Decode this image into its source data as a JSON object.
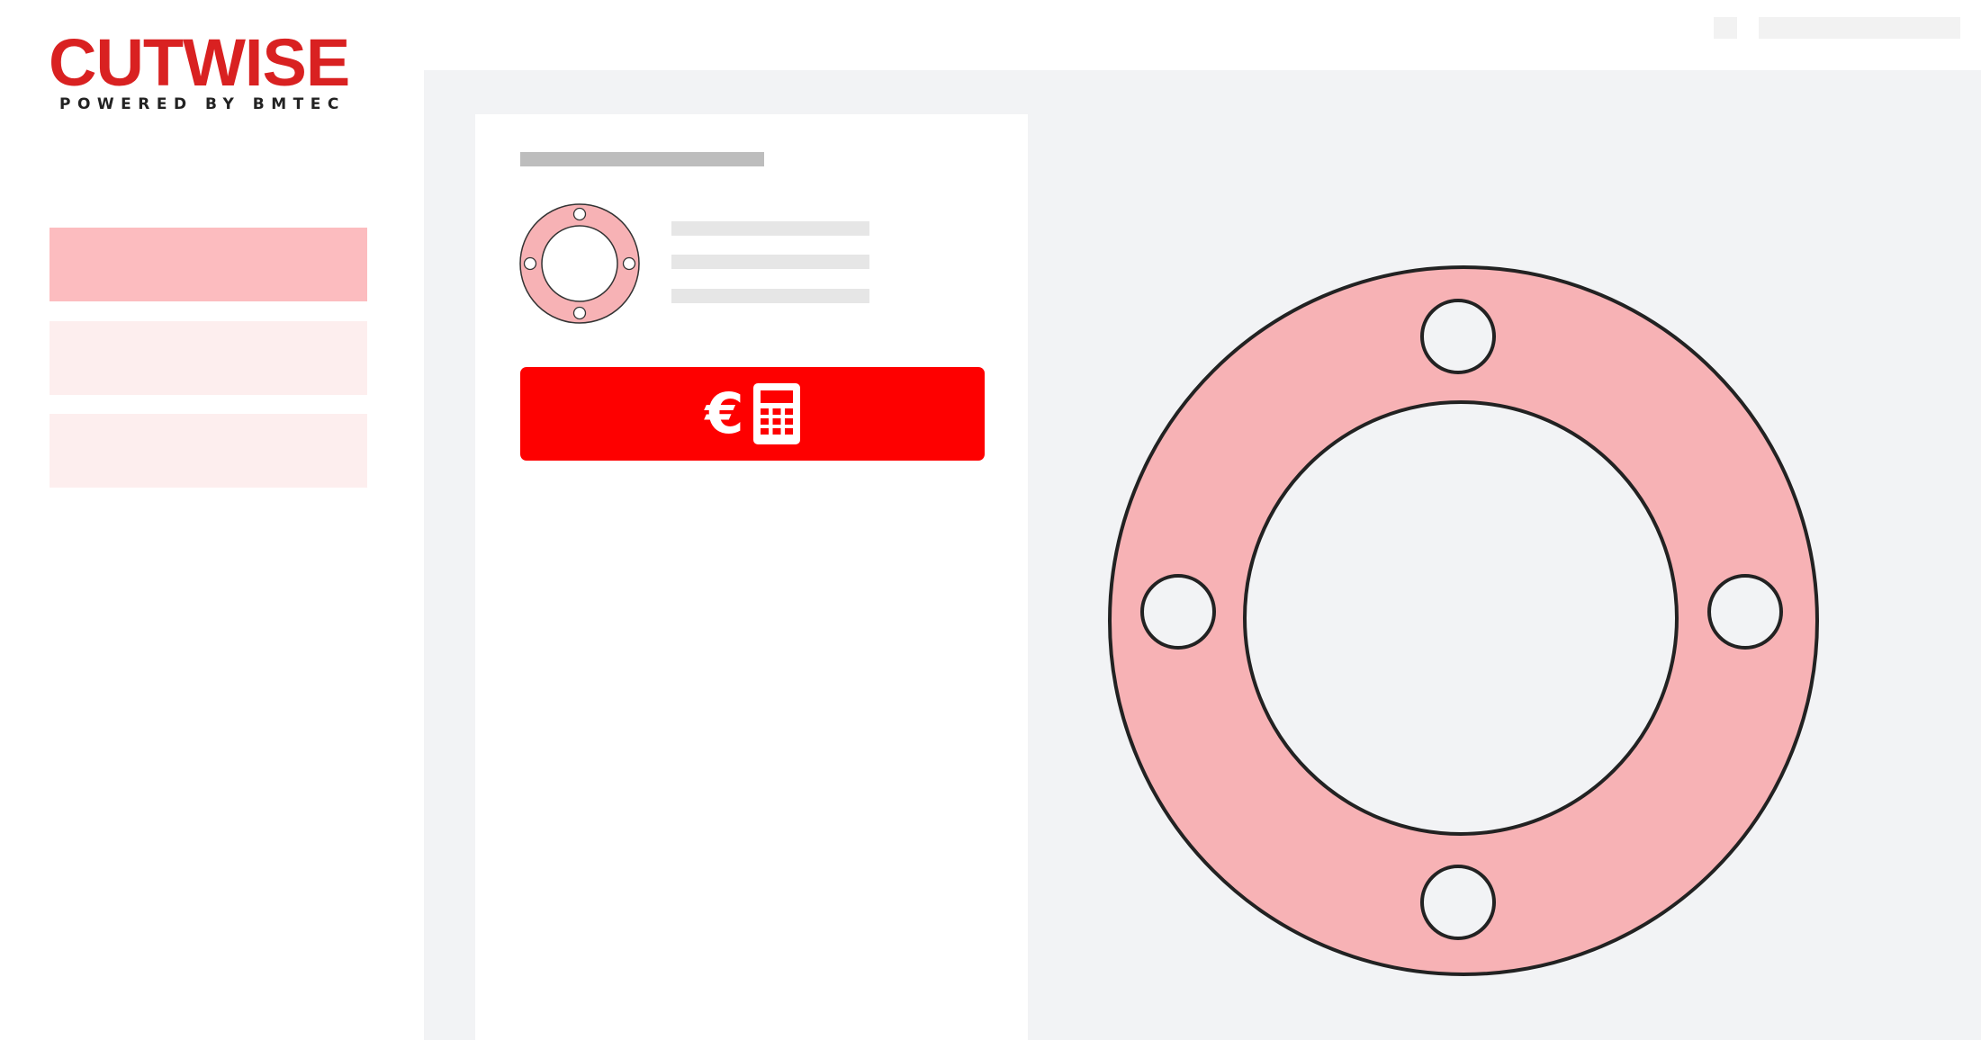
{
  "logo": {
    "title": "CUTWISE",
    "subtitle": "POWERED BY BMTEC"
  },
  "colors": {
    "brand_red": "#d92121",
    "button_red": "#fe0000",
    "active_sidebar": "#fcbcbf",
    "inactive_sidebar": "#fdeeee",
    "gasket_fill": "#f7b2b5",
    "workspace_bg": "#f2f3f5"
  },
  "sidebar": {
    "items": [
      {
        "state": "active"
      },
      {
        "state": "inactive"
      },
      {
        "state": "inactive"
      }
    ]
  },
  "panel": {
    "thumbnail": {
      "icon": "gasket-thumbnail-icon",
      "bolt_holes": 4
    },
    "calc_button": {
      "symbol": "€",
      "icons": [
        "euro-icon",
        "calculator-icon"
      ]
    }
  },
  "preview": {
    "shape": "ring-gasket",
    "bolt_holes": 4
  }
}
